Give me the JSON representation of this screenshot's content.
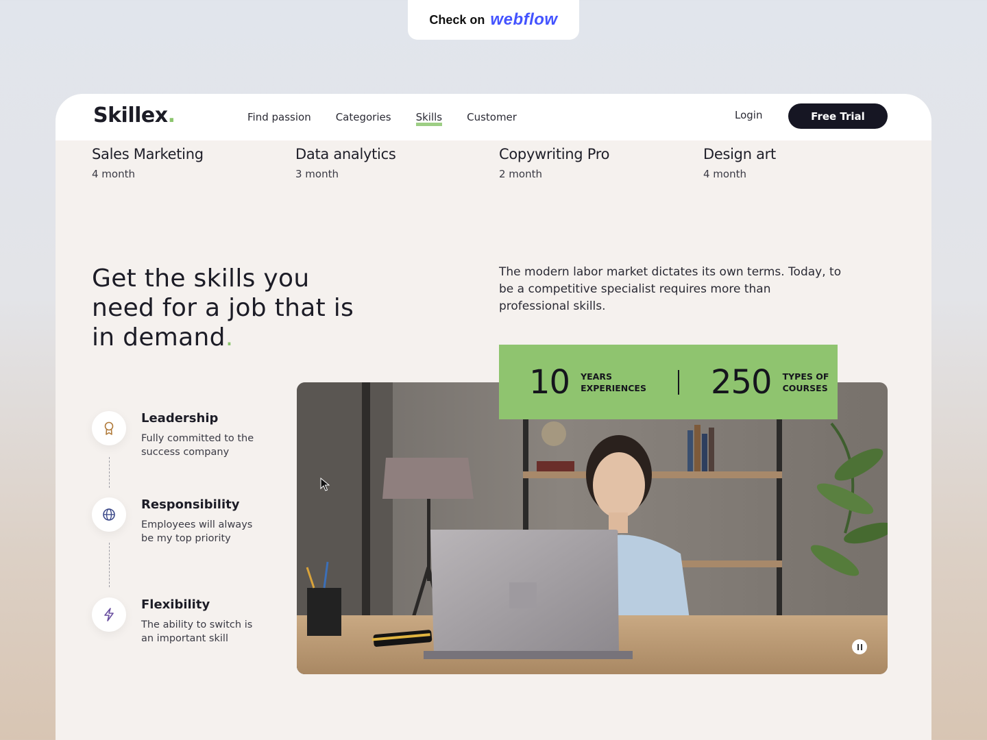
{
  "badge": {
    "prefix": "Check on",
    "brand": "webflow"
  },
  "nav": {
    "logo": "Skillex",
    "logo_dot": ".",
    "items": [
      "Find passion",
      "Categories",
      "Skills",
      "Customer"
    ],
    "active_item": "Skills",
    "login": "Login",
    "cta": "Free Trial"
  },
  "courses": [
    {
      "name": "Sales Marketing",
      "duration": "4 month"
    },
    {
      "name": "Data analytics",
      "duration": "3 month"
    },
    {
      "name": "Copywriting Pro",
      "duration": "2 month"
    },
    {
      "name": "Design art",
      "duration": "4 month"
    }
  ],
  "hero": {
    "headline": "Get the skills you need for a job that is in demand",
    "headline_dot": ".",
    "intro": "The modern labor market dictates its own terms. Today, to be a competitive specialist requires more than professional skills."
  },
  "features": [
    {
      "title": "Leadership",
      "desc": "Fully committed to the success company",
      "icon": "award-icon"
    },
    {
      "title": "Responsibility",
      "desc": "Employees will always be my top priority",
      "icon": "globe-icon"
    },
    {
      "title": "Flexibility",
      "desc": "The ability to switch is an important skill",
      "icon": "bolt-icon"
    }
  ],
  "stats": [
    {
      "number": "10",
      "label_1": "YEARS",
      "label_2": "EXPERIENCES"
    },
    {
      "number": "250",
      "label_1": "TYPES OF",
      "label_2": "COURSES"
    }
  ],
  "colors": {
    "accent": "#8fc46f",
    "dark": "#161623",
    "brand_webflow": "#4353ff"
  }
}
